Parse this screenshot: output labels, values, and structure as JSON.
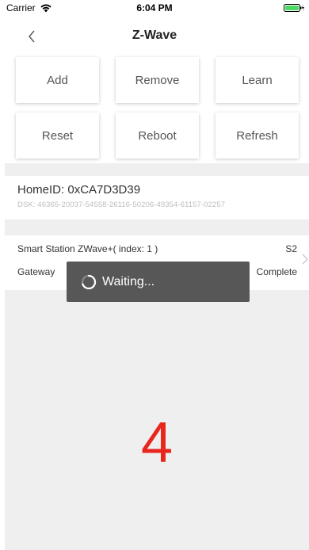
{
  "status_bar": {
    "carrier": "Carrier",
    "time": "6:04 PM",
    "wifi_icon": "wifi-icon",
    "battery_icon": "battery-charging-icon"
  },
  "nav": {
    "back_icon": "chevron-left-icon",
    "title": "Z-Wave"
  },
  "actions": [
    {
      "label": "Add"
    },
    {
      "label": "Remove"
    },
    {
      "label": "Learn"
    },
    {
      "label": "Reset"
    },
    {
      "label": "Reboot"
    },
    {
      "label": "Refresh"
    }
  ],
  "home": {
    "home_id": "HomeID: 0xCA7D3D39",
    "dsk": "DSK: 46365-20037-54558-26116-50206-49354-61157-02257"
  },
  "device": {
    "name": "Smart Station ZWave+( index: 1 )",
    "security": "S2",
    "type": "Gateway",
    "status": "Complete",
    "chevron_icon": "chevron-right-icon"
  },
  "hud": {
    "spinner_icon": "spinner-icon",
    "text": "Waiting..."
  },
  "overlay_number": "4",
  "colors": {
    "accent_red": "#e8261d",
    "hud_background": "#575757",
    "section_gray": "#efefef",
    "battery_green": "#4cd964"
  }
}
